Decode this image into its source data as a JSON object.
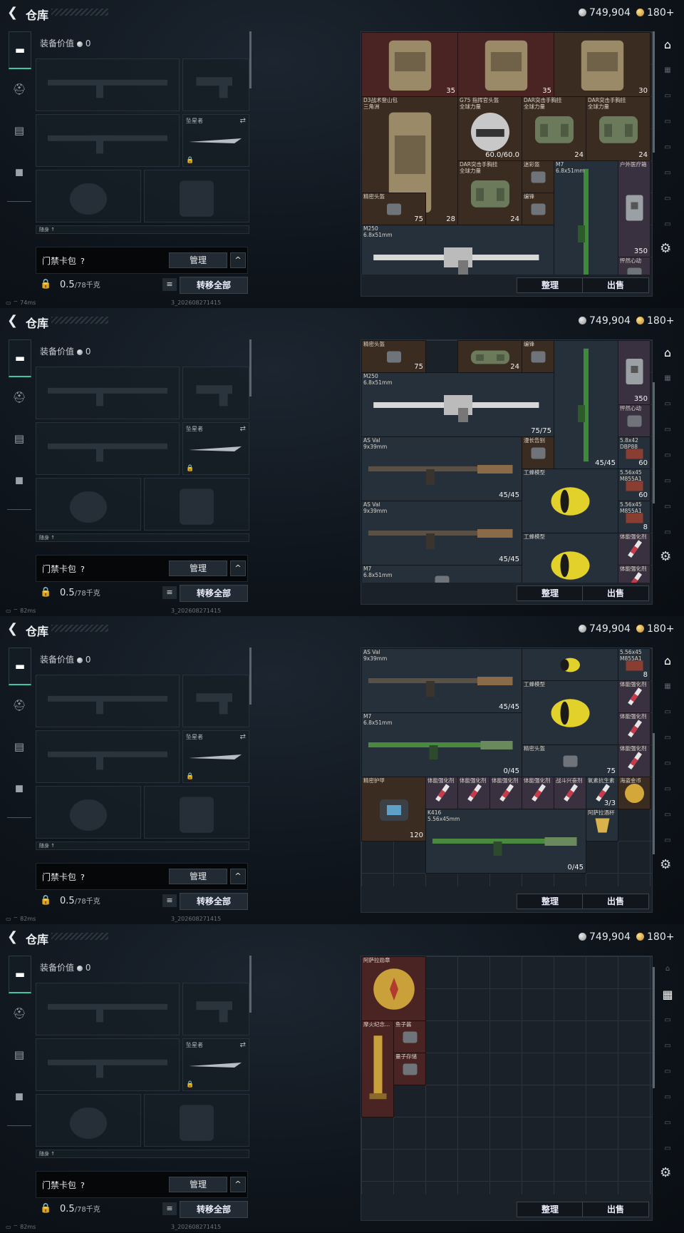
{
  "header": {
    "title": "仓库",
    "silver": "749,904",
    "gold": "180+"
  },
  "equipment": {
    "value_label": "装备价值",
    "value": "0",
    "melee_label": "坠星者",
    "partial_label": "随身 ↑"
  },
  "card_bag": {
    "label": "门禁卡包",
    "help": "?",
    "manage": "管理",
    "chevron": "^"
  },
  "weight": {
    "current": "0.5",
    "max": "/78千克"
  },
  "buttons": {
    "list": "≡",
    "transfer_all": "转移全部",
    "sort": "整理",
    "sell": "出售"
  },
  "frames": [
    {
      "ping": "74ms",
      "build": "3_202608271415",
      "items": [
        {
          "name": "",
          "count": "35",
          "col": 0,
          "row": 0,
          "w": 3,
          "h": 2,
          "bg": "red",
          "pic": "vest"
        },
        {
          "name": "",
          "count": "35",
          "col": 3,
          "row": 0,
          "w": 3,
          "h": 2,
          "bg": "red",
          "pic": "vest"
        },
        {
          "name": "",
          "count": "30",
          "col": 6,
          "row": 0,
          "w": 3,
          "h": 2,
          "bg": "brown",
          "pic": "vest"
        },
        {
          "name": "D3战术登山包\n三角洲",
          "count": "28",
          "col": 0,
          "row": 2,
          "w": 3,
          "h": 4,
          "bg": "brown",
          "pic": "backpack"
        },
        {
          "name": "G75 指挥官头盔\n全球力量",
          "count": "60.0/60.0",
          "col": 3,
          "row": 2,
          "w": 2,
          "h": 2,
          "bg": "brown",
          "pic": "helmet"
        },
        {
          "name": "DAR突击手胸挂\n全球力量",
          "count": "24",
          "col": 5,
          "row": 2,
          "w": 2,
          "h": 2,
          "bg": "brown",
          "pic": "rig"
        },
        {
          "name": "DAR突击手胸挂\n全球力量",
          "count": "24",
          "col": 7,
          "row": 2,
          "w": 2,
          "h": 2,
          "bg": "brown",
          "pic": "rig"
        },
        {
          "name": "DAR突击手胸挂\n全球力量",
          "count": "24",
          "col": 3,
          "row": 4,
          "w": 2,
          "h": 2,
          "bg": "brown",
          "pic": "rig"
        },
        {
          "name": "迷彩盔",
          "count": "",
          "col": 5,
          "row": 4,
          "w": 1,
          "h": 1,
          "bg": "brown",
          "pic": "small"
        },
        {
          "name": "M7\n6.8x51mm",
          "count": "",
          "col": 6,
          "row": 4,
          "w": 2,
          "h": 4,
          "bg": "dark",
          "pic": "rifle-green"
        },
        {
          "name": "户外医疗箱",
          "count": "350",
          "col": 8,
          "row": 4,
          "w": 1,
          "h": 3,
          "bg": "purple",
          "pic": "medkit"
        },
        {
          "name": "精密头盔",
          "count": "75",
          "col": 0,
          "row": 5,
          "w": 2,
          "h": 1,
          "bg": "brown",
          "pic": "small"
        },
        {
          "name": "编锋",
          "count": "",
          "col": 5,
          "row": 5,
          "w": 1,
          "h": 1,
          "bg": "brown",
          "pic": "small"
        },
        {
          "name": "M250\n6.8x51mm",
          "count": "",
          "col": 0,
          "row": 6,
          "w": 6,
          "h": 2,
          "bg": "dark",
          "pic": "lmg"
        },
        {
          "name": "怦然心动",
          "count": "",
          "col": 8,
          "row": 7,
          "w": 1,
          "h": 1,
          "bg": "purple",
          "pic": "small"
        }
      ]
    },
    {
      "ping": "82ms",
      "build": "3_202608271415",
      "items": [
        {
          "name": "精密头盔",
          "count": "75",
          "col": 0,
          "row": 0,
          "w": 2,
          "h": 1,
          "bg": "brown",
          "pic": "small"
        },
        {
          "name": "",
          "count": "24",
          "col": 3,
          "row": 0,
          "w": 2,
          "h": 1,
          "bg": "brown",
          "pic": "rig"
        },
        {
          "name": "编锋",
          "count": "",
          "col": 5,
          "row": 0,
          "w": 1,
          "h": 1,
          "bg": "brown",
          "pic": "small"
        },
        {
          "name": "",
          "count": "45/45",
          "col": 6,
          "row": 0,
          "w": 2,
          "h": 4,
          "bg": "dark",
          "pic": "rifle-green"
        },
        {
          "name": "",
          "count": "350",
          "col": 8,
          "row": 0,
          "w": 1,
          "h": 2,
          "bg": "purple",
          "pic": "medkit"
        },
        {
          "name": "M250\n6.8x51mm",
          "count": "75/75",
          "col": 0,
          "row": 1,
          "w": 6,
          "h": 2,
          "bg": "dark",
          "pic": "lmg"
        },
        {
          "name": "怦然心动",
          "count": "",
          "col": 8,
          "row": 2,
          "w": 1,
          "h": 1,
          "bg": "purple",
          "pic": "small"
        },
        {
          "name": "AS Val\n9x39mm",
          "count": "45/45",
          "col": 0,
          "row": 3,
          "w": 5,
          "h": 2,
          "bg": "dark",
          "pic": "rifle"
        },
        {
          "name": "漫长告别",
          "count": "",
          "col": 5,
          "row": 3,
          "w": 1,
          "h": 1,
          "bg": "brown",
          "pic": "small"
        },
        {
          "name": "5.8x42\nDBP88",
          "count": "60",
          "col": 8,
          "row": 3,
          "w": 1,
          "h": 1,
          "bg": "dark",
          "pic": "ammo"
        },
        {
          "name": "工蜂模型",
          "count": "",
          "col": 5,
          "row": 4,
          "w": 3,
          "h": 2,
          "bg": "dark",
          "pic": "bee"
        },
        {
          "name": "5.56x45\nM855A1",
          "count": "60",
          "col": 8,
          "row": 4,
          "w": 1,
          "h": 1,
          "bg": "dark",
          "pic": "ammo"
        },
        {
          "name": "AS Val\n9x39mm",
          "count": "45/45",
          "col": 0,
          "row": 5,
          "w": 5,
          "h": 2,
          "bg": "dark",
          "pic": "rifle"
        },
        {
          "name": "5.56x45\nM855A1",
          "count": "8",
          "col": 8,
          "row": 5,
          "w": 1,
          "h": 1,
          "bg": "dark",
          "pic": "ammo"
        },
        {
          "name": "工蜂模型",
          "count": "",
          "col": 5,
          "row": 6,
          "w": 3,
          "h": 2,
          "bg": "dark",
          "pic": "bee"
        },
        {
          "name": "体能强化剂",
          "count": "",
          "col": 8,
          "row": 6,
          "w": 1,
          "h": 1,
          "bg": "purple",
          "pic": "syringe"
        },
        {
          "name": "M7\n6.8x51mm",
          "count": "",
          "col": 0,
          "row": 7,
          "w": 5,
          "h": 1,
          "bg": "dark",
          "pic": "small"
        },
        {
          "name": "体能强化剂",
          "count": "",
          "col": 8,
          "row": 7,
          "w": 1,
          "h": 1,
          "bg": "purple",
          "pic": "syringe"
        }
      ]
    },
    {
      "ping": "82ms",
      "build": "3_202608271415",
      "items": [
        {
          "name": "AS Val\n9x39mm",
          "count": "45/45",
          "col": 0,
          "row": 0,
          "w": 5,
          "h": 2,
          "bg": "dark",
          "pic": "rifle"
        },
        {
          "name": "",
          "count": "",
          "col": 5,
          "row": 0,
          "w": 3,
          "h": 1,
          "bg": "dark",
          "pic": "bee"
        },
        {
          "name": "5.56x45\nM855A1",
          "count": "8",
          "col": 8,
          "row": 0,
          "w": 1,
          "h": 1,
          "bg": "dark",
          "pic": "ammo"
        },
        {
          "name": "工蜂模型",
          "count": "",
          "col": 5,
          "row": 1,
          "w": 3,
          "h": 2,
          "bg": "dark",
          "pic": "bee"
        },
        {
          "name": "体能强化剂",
          "count": "",
          "col": 8,
          "row": 1,
          "w": 1,
          "h": 1,
          "bg": "purple",
          "pic": "syringe"
        },
        {
          "name": "M7\n6.8x51mm",
          "count": "0/45",
          "col": 0,
          "row": 2,
          "w": 5,
          "h": 2,
          "bg": "dark",
          "pic": "rifle-green"
        },
        {
          "name": "体能强化剂",
          "count": "",
          "col": 8,
          "row": 2,
          "w": 1,
          "h": 1,
          "bg": "purple",
          "pic": "syringe"
        },
        {
          "name": "精密头盔",
          "count": "75",
          "col": 5,
          "row": 3,
          "w": 3,
          "h": 1,
          "bg": "dark",
          "pic": "small"
        },
        {
          "name": "体能强化剂",
          "count": "",
          "col": 8,
          "row": 3,
          "w": 1,
          "h": 1,
          "bg": "purple",
          "pic": "syringe"
        },
        {
          "name": "精密护甲",
          "count": "120",
          "col": 0,
          "row": 4,
          "w": 2,
          "h": 2,
          "bg": "brown",
          "pic": "armor"
        },
        {
          "name": "体能强化剂",
          "count": "",
          "col": 2,
          "row": 4,
          "w": 1,
          "h": 1,
          "bg": "purple",
          "pic": "syringe"
        },
        {
          "name": "体能强化剂",
          "count": "",
          "col": 3,
          "row": 4,
          "w": 1,
          "h": 1,
          "bg": "purple",
          "pic": "syringe"
        },
        {
          "name": "体能强化剂",
          "count": "",
          "col": 4,
          "row": 4,
          "w": 1,
          "h": 1,
          "bg": "purple",
          "pic": "syringe"
        },
        {
          "name": "体能强化剂",
          "count": "",
          "col": 5,
          "row": 4,
          "w": 1,
          "h": 1,
          "bg": "purple",
          "pic": "syringe"
        },
        {
          "name": "战斗兴奋剂",
          "count": "",
          "col": 6,
          "row": 4,
          "w": 1,
          "h": 1,
          "bg": "purple",
          "pic": "syringe"
        },
        {
          "name": "氧素抗生素",
          "count": "3/3",
          "col": 7,
          "row": 4,
          "w": 1,
          "h": 1,
          "bg": "dark",
          "pic": "syringe"
        },
        {
          "name": "海盗金币",
          "count": "",
          "col": 8,
          "row": 4,
          "w": 1,
          "h": 1,
          "bg": "brown",
          "pic": "coin"
        },
        {
          "name": "K416\n5.56x45mm",
          "count": "0/45",
          "col": 2,
          "row": 5,
          "w": 5,
          "h": 2,
          "bg": "dark",
          "pic": "rifle-green"
        },
        {
          "name": "阿萨拉酒杯",
          "count": "",
          "col": 7,
          "row": 5,
          "w": 1,
          "h": 1,
          "bg": "dark",
          "pic": "cup"
        }
      ]
    },
    {
      "ping": "82ms",
      "build": "3_202608271415",
      "items": [
        {
          "name": "阿萨拉勋章",
          "count": "",
          "col": 0,
          "row": 0,
          "w": 2,
          "h": 2,
          "bg": "red",
          "pic": "medal"
        },
        {
          "name": "摩火纪念...",
          "count": "",
          "col": 0,
          "row": 2,
          "w": 1,
          "h": 3,
          "bg": "red",
          "pic": "trophy"
        },
        {
          "name": "鱼子酱",
          "count": "",
          "col": 1,
          "row": 2,
          "w": 1,
          "h": 1,
          "bg": "red",
          "pic": "small"
        },
        {
          "name": "量子存储",
          "count": "",
          "col": 1,
          "row": 3,
          "w": 1,
          "h": 1,
          "bg": "red",
          "pic": "small"
        }
      ]
    }
  ]
}
